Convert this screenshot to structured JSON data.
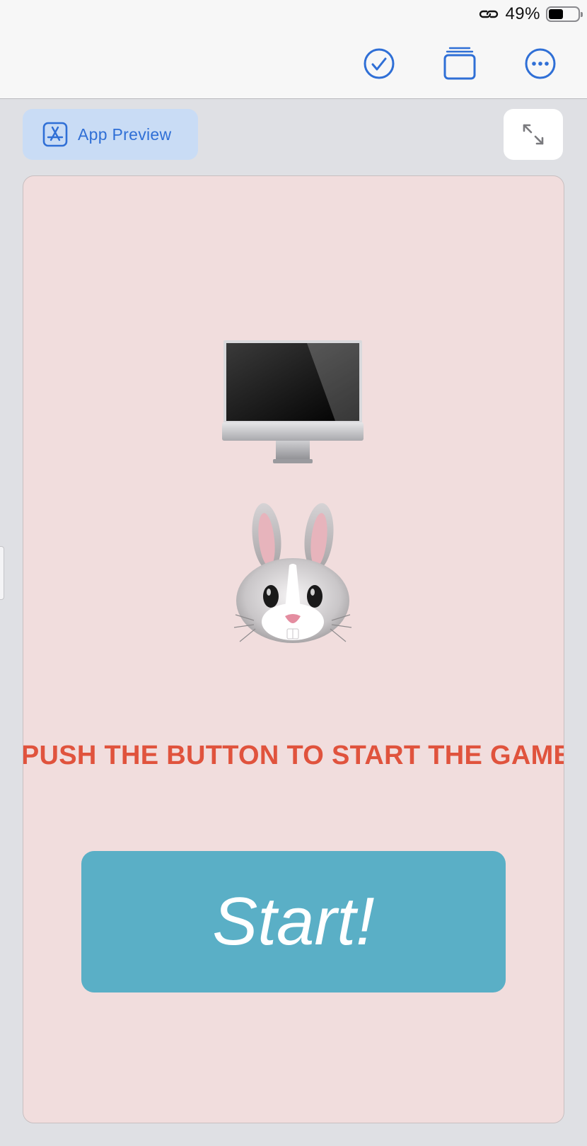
{
  "status_bar": {
    "link_icon": "link-icon",
    "battery_percent": "49%",
    "battery_level": 0.49
  },
  "toolbar": {
    "check_icon": "checkmark-circle-icon",
    "windows_icon": "stacked-windows-icon",
    "more_icon": "ellipsis-circle-icon"
  },
  "header": {
    "app_preview_label": "App Preview",
    "app_preview_icon": "app-store-icon",
    "expand_icon": "expand-arrows-icon"
  },
  "preview": {
    "computer_icon": "desktop-computer-emoji",
    "rabbit_icon": "rabbit-face-emoji",
    "prompt_text": "PUSH THE BUTTON TO START THE GAME",
    "start_label": "Start!"
  },
  "colors": {
    "accent": "#2f6fd6",
    "preview_bg": "#f1dddd",
    "prompt": "#e0533d",
    "start_button": "#5aafc6"
  }
}
